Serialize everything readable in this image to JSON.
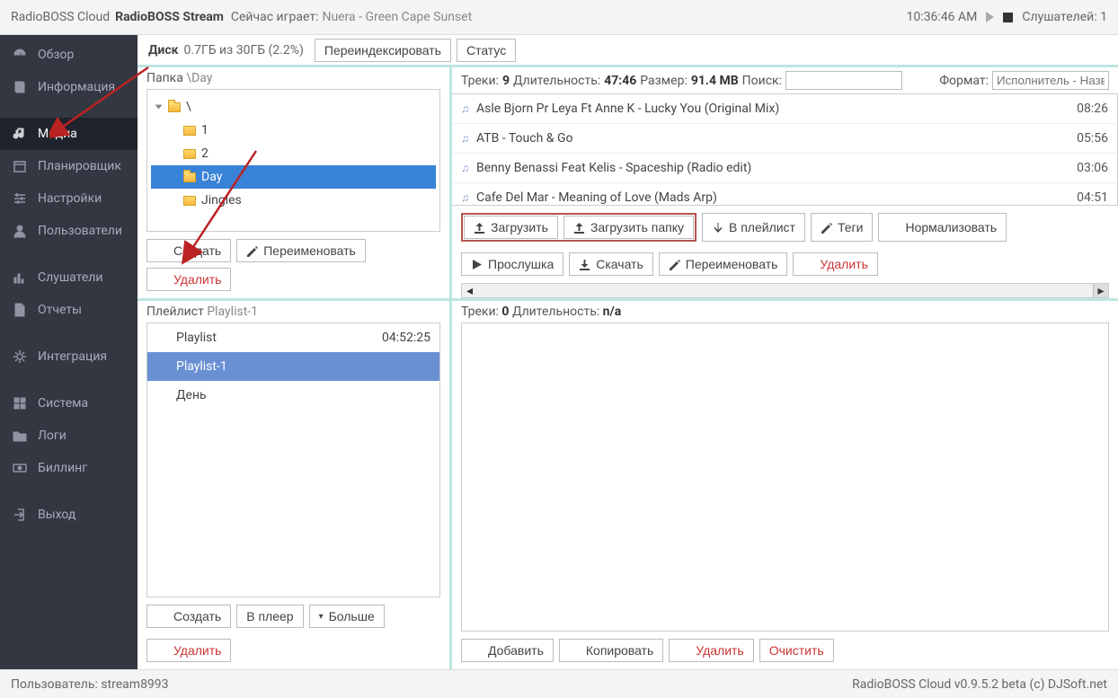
{
  "topbar": {
    "brand1": "RadioBOSS Cloud",
    "brand2": "RadioBOSS Stream",
    "np_label": "Сейчас играет:",
    "np_track": "Nuera - Green Cape Sunset",
    "clock": "10:36:46 AM",
    "listeners_label": "Слушателей: 1"
  },
  "sidebar": {
    "items": [
      {
        "label": "Обзор",
        "icon": "gauge"
      },
      {
        "label": "Информация",
        "icon": "book"
      },
      {
        "label": "Медиа",
        "icon": "music",
        "active": true
      },
      {
        "label": "Планировщик",
        "icon": "calendar"
      },
      {
        "label": "Настройки",
        "icon": "sliders"
      },
      {
        "label": "Пользователи",
        "icon": "user"
      },
      {
        "label": "Слушатели",
        "icon": "bars"
      },
      {
        "label": "Отчеты",
        "icon": "doc"
      },
      {
        "label": "Интеграция",
        "icon": "cogs"
      },
      {
        "label": "Система",
        "icon": "grid"
      },
      {
        "label": "Логи",
        "icon": "folder"
      },
      {
        "label": "Биллинг",
        "icon": "money"
      },
      {
        "label": "Выход",
        "icon": "exit"
      }
    ]
  },
  "disk": {
    "label": "Диск",
    "usage": "0.7ГБ из 30ГБ (2.2%)",
    "reindex": "Переиндексировать",
    "status": "Статус"
  },
  "folders": {
    "header_label": "Папка",
    "path": "\\Day",
    "tree": [
      {
        "label": "\\",
        "depth": 0,
        "open": true
      },
      {
        "label": "1",
        "depth": 1
      },
      {
        "label": "2",
        "depth": 1
      },
      {
        "label": "Day",
        "depth": 1,
        "selected": true
      },
      {
        "label": "Jingles",
        "depth": 1
      }
    ],
    "btn_create": "Создать",
    "btn_rename": "Переименовать",
    "btn_delete": "Удалить"
  },
  "tracks": {
    "h_tracks": "Треки:",
    "h_tracks_v": "9",
    "h_dur": "Длительность:",
    "h_dur_v": "47:46",
    "h_size": "Размер:",
    "h_size_v": "91.4 MB",
    "h_search": "Поиск:",
    "h_format": "Формат:",
    "h_format_ph": "Исполнитель - Название",
    "list": [
      {
        "title": "Asle Bjorn Pr Leya Ft Anne K - Lucky You (Original Mix)",
        "dur": "08:26"
      },
      {
        "title": "ATB - Touch & Go",
        "dur": "05:56"
      },
      {
        "title": "Benny Benassi Feat Kelis - Spaceship (Radio edit)",
        "dur": "03:06"
      },
      {
        "title": "Cafe Del Mar - Meaning of Love (Mads Arp)",
        "dur": "04:51"
      }
    ],
    "btn_upload": "Загрузить",
    "btn_upload_folder": "Загрузить папку",
    "btn_to_playlist": "В плейлист",
    "btn_tags": "Теги",
    "btn_normalize": "Нормализовать",
    "btn_preview": "Прослушка",
    "btn_download": "Скачать",
    "btn_rename": "Переименовать",
    "btn_delete": "Удалить"
  },
  "playlists": {
    "header_label": "Плейлист",
    "current": "Playlist-1",
    "list": [
      {
        "name": "Playlist",
        "dur": "04:52:25"
      },
      {
        "name": "Playlist-1",
        "selected": true
      },
      {
        "name": "День"
      }
    ],
    "btn_create": "Создать",
    "btn_to_player": "В плеер",
    "btn_more": "Больше",
    "btn_delete": "Удалить"
  },
  "playlist_tracks": {
    "h_tracks": "Треки:",
    "h_tracks_v": "0",
    "h_dur": "Длительность:",
    "h_dur_v": "n/a",
    "btn_add": "Добавить",
    "btn_copy": "Копировать",
    "btn_delete": "Удалить",
    "btn_clear": "Очистить"
  },
  "footer": {
    "user": "Пользователь: stream8993",
    "version": "RadioBOSS Cloud v0.9.5.2 beta (c) DJSoft.net"
  }
}
